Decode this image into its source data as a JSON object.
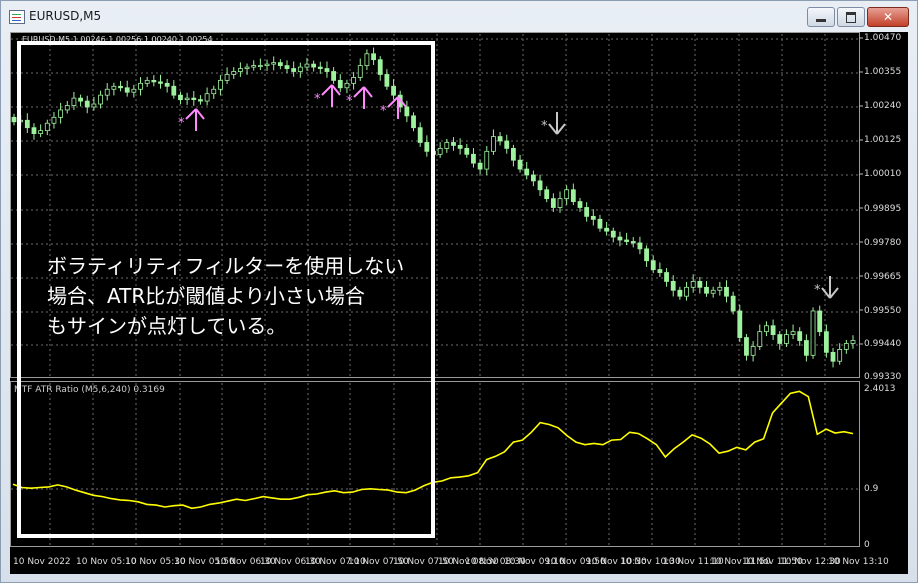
{
  "window": {
    "title": "EURUSD,M5",
    "controls": [
      "minimize",
      "maximize",
      "close"
    ]
  },
  "chart": {
    "symbol_label": "EURUSD,M5  1.00246 1.00256 1.00240 1.00254",
    "price_axis": [
      "1.00470",
      "1.00355",
      "1.00240",
      "1.00125",
      "1.00010",
      "0.99895",
      "0.99780",
      "0.99665",
      "0.99550",
      "0.99440",
      "0.99330"
    ],
    "time_axis": [
      "10 Nov 2022",
      "10 Nov 05:10",
      "10 Nov 05:30",
      "10 Nov 05:50",
      "10 Nov 06:30",
      "10 Nov 06:30",
      "10 Nov 07:10",
      "10 Nov 07:50",
      "10 Nov 07:50",
      "10 Nov 08:30",
      "10 Nov 08:30",
      "10 Nov 09:10",
      "10 Nov 09:50",
      "10 Nov 10:30",
      "10 Nov 10:30",
      "10 Nov 11:10",
      "10 Nov 11:50",
      "10 Nov 11:50",
      "10 Nov 12:30",
      "10 Nov 13:10"
    ],
    "colors": {
      "background": "#000000",
      "grid": "#6b6b6b",
      "candle": "#9ef29e",
      "indicator": "#ffff00",
      "buy_arrow": "#ff88ff",
      "sell_arrow": "#c8c8c8",
      "note_frame": "#ffffff"
    },
    "buy_signals": 4,
    "sell_signals": 2
  },
  "indicator": {
    "label": "MTF ATR Ratio  (M5,6,240) 0.3169",
    "axis": [
      "2.4013",
      "0.9",
      "0"
    ]
  },
  "annotation": {
    "text": "ボラティリティフィルターを使用しない\n場合、ATR比が閾値より小さい場合\nもサインが点灯している。"
  }
}
